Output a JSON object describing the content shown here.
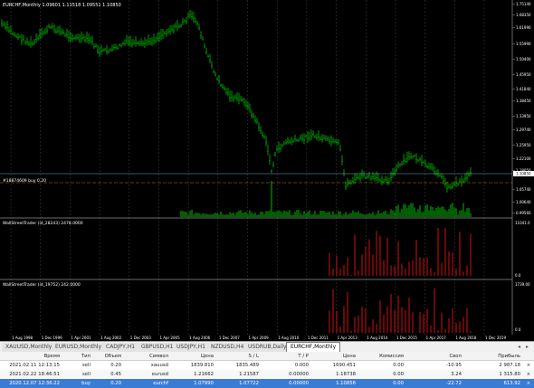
{
  "chart": {
    "symbol_header": "EURCHF,Monthly  1.09601 1.11518 1.09551 1.10850",
    "indicator1_label": "WallStreetTrader (id_28243) 2478.0000",
    "indicator2_label": "WallStreetTrader (id_19752) 242.0000",
    "order_line_label": "#18874609 buy 0.20",
    "price_axis": [
      "1.75140",
      "1.68350",
      "1.61990",
      "1.55990",
      "1.50400",
      "1.45950",
      "1.41840",
      "1.38450",
      "1.33950",
      "1.29740",
      "1.25950",
      "1.22100",
      "1.18050",
      "1.05740",
      "1.00640",
      "0.99560"
    ],
    "current_price_tag": "1.10850",
    "ind1_axis": [
      "11041.0",
      "0.0"
    ],
    "ind2_axis": [
      "1739.00",
      "0.0"
    ],
    "date_axis": [
      "1 Aug 1998",
      "1 Dec 1999",
      "1 Apr 2001",
      "1 Aug 2002",
      "1 Dec 2003",
      "1 Apr 2005",
      "1 Aug 2006",
      "1 Dec 2007",
      "1 Apr 2009",
      "1 Aug 2010",
      "1 Dec 2011",
      "1 Apr 2013",
      "1 Aug 2014",
      "1 Dec 2015",
      "1 Apr 2017",
      "1 Aug 2018",
      "1 Dec 2019"
    ],
    "colors": {
      "candles": "#00c000",
      "volume": "#00c000",
      "ind_bars": "#d01010",
      "grid": "#404040",
      "bid_line": "#7aa6c8",
      "order_line": "#c08000"
    }
  },
  "tabs": [
    "XAUUSD,Monthly",
    "EURUSD,Monthly",
    "CADJPY,H1",
    "GBPUSD,H1",
    "USDJPY,H1",
    "NZDUSD,H4",
    "USDRUB,Daily",
    "EURCHF,Monthly"
  ],
  "active_tab": "EURCHF,Monthly",
  "table": {
    "headers": {
      "time": "Время",
      "type": "Тип",
      "volume": "Объем",
      "symbol": "Символ",
      "price": "Цена",
      "sl": "S / L",
      "tp": "T / P",
      "current": "Цена",
      "commission": "Комиссия",
      "swap": "Своп",
      "profit": "Прибыль"
    },
    "rows": [
      {
        "time": "2021.02.11 12:13:15",
        "type": "sell",
        "volume": "0.20",
        "symbol": "xauusd",
        "price": "1839.810",
        "sl": "1835.489",
        "tp": "0.000",
        "current": "1690.451",
        "commission": "0.00",
        "swap": "-10.95",
        "profit": "2 987.18"
      },
      {
        "time": "2021.02.22 18:46:51",
        "type": "sell",
        "volume": "0.45",
        "symbol": "eurusd",
        "price": "1.21662",
        "sl": "1.21587",
        "tp": "0.00000",
        "current": "1.18738",
        "commission": "0.00",
        "swap": "3.24",
        "profit": "1 315.80"
      },
      {
        "time": "2020.12.07 12:36:22",
        "type": "buy",
        "volume": "0.20",
        "symbol": "eurchf",
        "price": "1.07990",
        "sl": "1.07722",
        "tp": "0.00000",
        "current": "1.10856",
        "commission": "0.00",
        "swap": "-22.72",
        "profit": "613.92"
      }
    ]
  }
}
